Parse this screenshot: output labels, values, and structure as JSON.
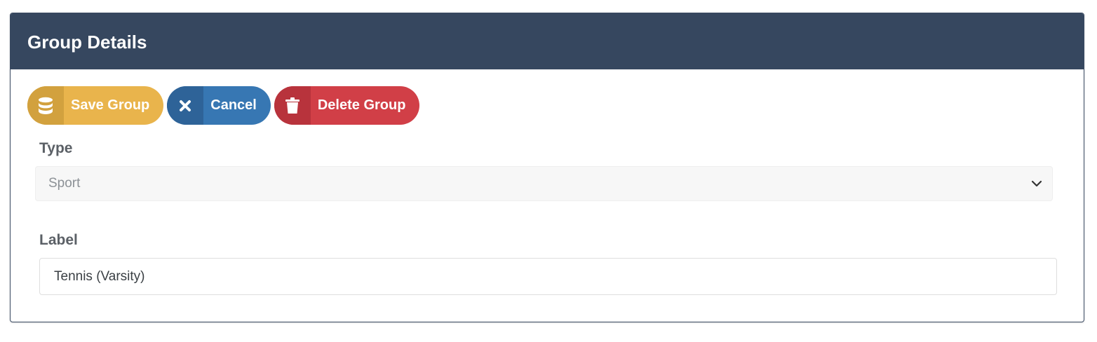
{
  "panel": {
    "title": "Group Details"
  },
  "toolbar": {
    "save_label": "Save Group",
    "save_icon": "database-icon",
    "cancel_label": "Cancel",
    "cancel_icon": "close-icon",
    "delete_label": "Delete Group",
    "delete_icon": "trash-icon"
  },
  "form": {
    "type": {
      "label": "Type",
      "selected_value": "Sport"
    },
    "label": {
      "label": "Label",
      "value": "Tennis (Varsity)"
    }
  },
  "colors": {
    "header_bg": "#36475f",
    "save": "#e9b44c",
    "cancel": "#3777b3",
    "delete": "#d13f47"
  }
}
